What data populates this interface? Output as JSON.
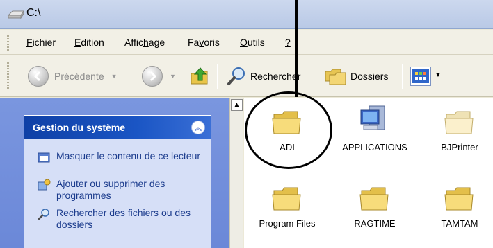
{
  "window": {
    "title": "C:\\"
  },
  "menu": [
    {
      "pre": "",
      "u": "F",
      "post": "ichier"
    },
    {
      "pre": "",
      "u": "E",
      "post": "dition"
    },
    {
      "pre": "Affic",
      "u": "h",
      "post": "age"
    },
    {
      "pre": "Fa",
      "u": "v",
      "post": "oris"
    },
    {
      "pre": "",
      "u": "O",
      "post": "utils"
    },
    {
      "pre": "",
      "u": "?",
      "post": ""
    }
  ],
  "toolbar": {
    "back_label": "Précédente",
    "search_label": "Rechercher",
    "folders_label": "Dossiers"
  },
  "tasks": {
    "title": "Gestion du système",
    "links": [
      "Masquer le contenu de ce lecteur",
      "Ajouter ou supprimer des programmes",
      "Rechercher des fichiers ou des dossiers"
    ]
  },
  "files": [
    {
      "name": "ADI",
      "icon": "folder-icon"
    },
    {
      "name": "APPLICATIONS",
      "icon": "computer-folder-icon"
    },
    {
      "name": "BJPrinter",
      "icon": "folder-icon"
    },
    {
      "name": "Program Files",
      "icon": "folder-icon"
    },
    {
      "name": "RAGTIME",
      "icon": "folder-icon"
    },
    {
      "name": "TAMTAM",
      "icon": "folder-icon"
    }
  ],
  "colors": {
    "task_header": "#1a55c4",
    "left_pane": "#6b88d8",
    "link": "#1c3c8d"
  }
}
